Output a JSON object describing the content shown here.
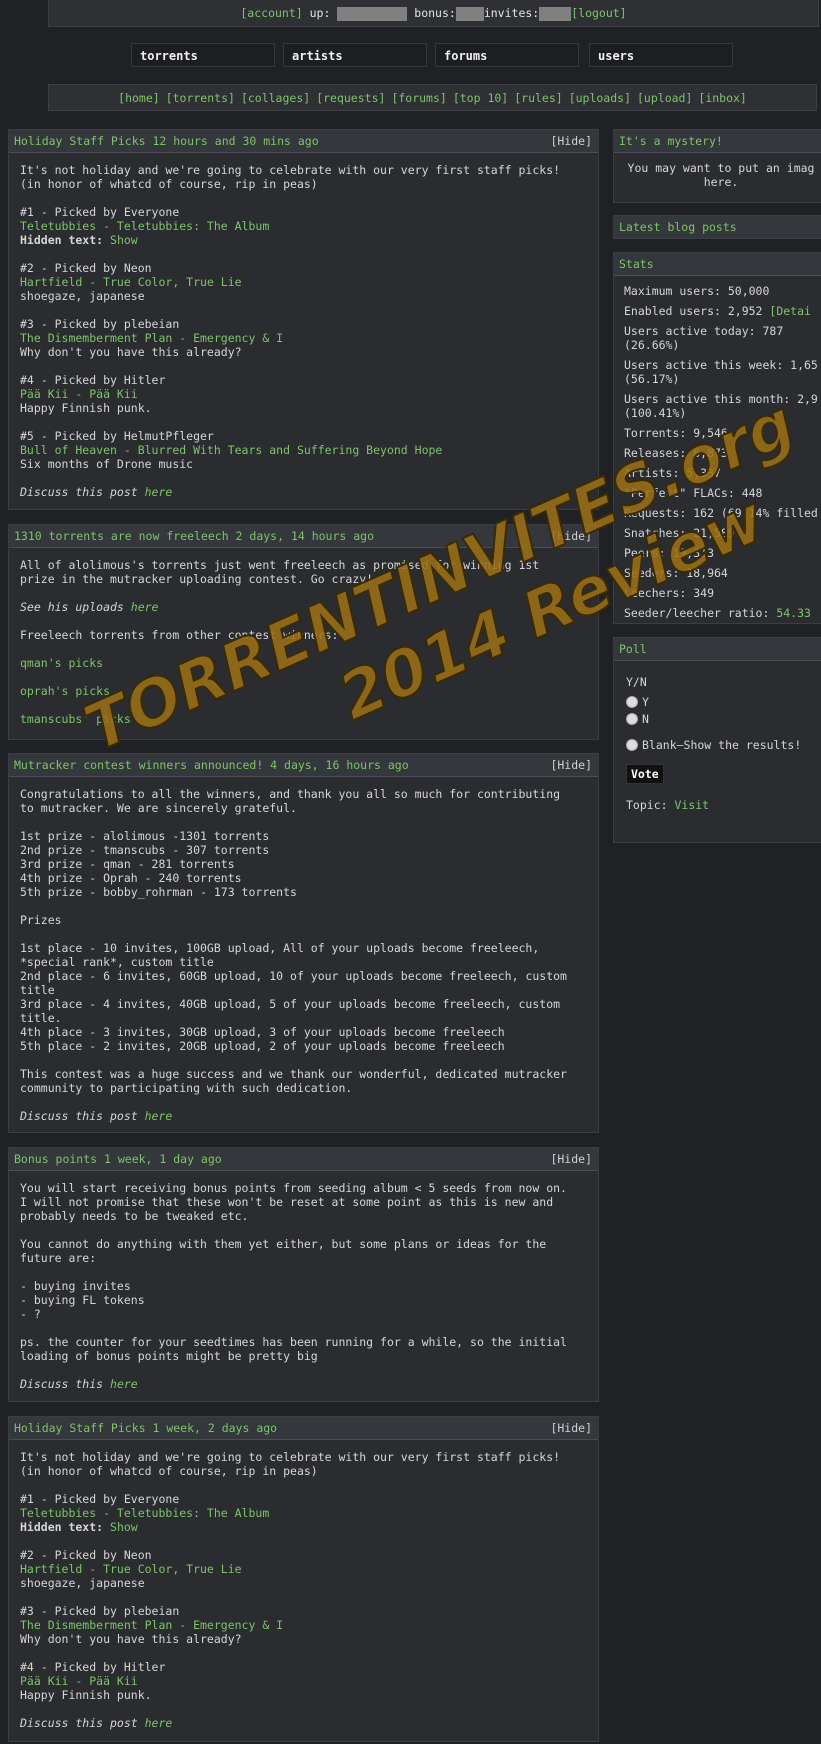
{
  "userbar": {
    "account": "[account]",
    "up_label": "up:",
    "bonus_label": "bonus:",
    "invites_label": "invites:",
    "logout": "[logout]"
  },
  "mainnav": [
    "torrents",
    "artists",
    "forums",
    "users"
  ],
  "subnav": [
    "[home]",
    "[torrents]",
    "[collages]",
    "[requests]",
    "[forums]",
    "[top 10]",
    "[rules]",
    "[uploads]",
    "[upload]",
    "[inbox]"
  ],
  "posts": [
    {
      "title": "Holiday Staff Picks 12 hours and 30 mins ago",
      "hide": "[Hide]",
      "lines": [
        {
          "t": "It's not holiday and we're going to celebrate with our very first staff picks!"
        },
        {
          "t": "(in honor of whatcd of course, rip in peas)"
        },
        {
          "gap": true
        },
        {
          "t": "#1 - Picked by Everyone"
        },
        {
          "t": "Teletubbies - Teletubbies: The Album",
          "c": "green"
        },
        {
          "t": "Hidden text:",
          "c": "bold",
          "suffix": " Show"
        },
        {
          "gap": true
        },
        {
          "t": "#2 - Picked by Neon"
        },
        {
          "t": "Hartfield - True Color, True Lie",
          "c": "green"
        },
        {
          "t": "shoegaze, japanese"
        },
        {
          "gap": true
        },
        {
          "t": "#3 - Picked by plebeian"
        },
        {
          "t": "The Dismemberment Plan - Emergency & I",
          "c": "green"
        },
        {
          "t": "Why don't you have this already?"
        },
        {
          "gap": true
        },
        {
          "t": "#4 - Picked by Hitler"
        },
        {
          "t": "Pää Kii - Pää Kii",
          "c": "green"
        },
        {
          "t": "Happy Finnish punk."
        },
        {
          "gap": true
        },
        {
          "t": "#5 - Picked by HelmutPfleger"
        },
        {
          "t": "Bull of Heaven - Blurred With Tears and Suffering Beyond Hope",
          "c": "green"
        },
        {
          "t": "Six months of Drone music"
        },
        {
          "gap": true
        },
        {
          "t": "Discuss this post ",
          "c": "ital",
          "suffix": "here"
        }
      ]
    },
    {
      "title": "1310 torrents are now freeleech 2 days, 14 hours ago",
      "hide": "[Hide]",
      "lines": [
        {
          "t": "All of alolimous's torrents just went freeleech as promised for winning 1st"
        },
        {
          "t": "prize in the mutracker uploading contest. Go crazy!"
        },
        {
          "gap": true
        },
        {
          "t": "See his uploads ",
          "c": "ital",
          "suffix": "here"
        },
        {
          "gap": true
        },
        {
          "t": "Freeleech torrents from other contest winners:"
        },
        {
          "gap": true
        },
        {
          "t": "qman's picks",
          "c": "green"
        },
        {
          "gap": true
        },
        {
          "t": "oprah's picks",
          "c": "green"
        },
        {
          "gap": true
        },
        {
          "t": "tmanscubs' picks",
          "c": "green"
        }
      ]
    },
    {
      "title": "Mutracker contest winners announced! 4 days, 16 hours ago",
      "hide": "[Hide]",
      "lines": [
        {
          "t": "Congratulations to all the winners, and thank you all so much for contributing"
        },
        {
          "t": "to mutracker. We are sincerely grateful."
        },
        {
          "gap": true
        },
        {
          "t": "1st prize - alolimous -1301 torrents"
        },
        {
          "t": "2nd prize - tmanscubs - 307 torrents"
        },
        {
          "t": "3rd prize - qman - 281 torrents"
        },
        {
          "t": "4th prize - Oprah - 240 torrents"
        },
        {
          "t": "5th prize - bobby_rohrman - 173 torrents"
        },
        {
          "gap": true
        },
        {
          "t": "Prizes"
        },
        {
          "gap": true
        },
        {
          "t": "1st place - 10 invites, 100GB upload, All of your uploads become freeleech,"
        },
        {
          "t": "*special rank*, custom title"
        },
        {
          "t": "2nd place - 6 invites, 60GB upload, 10 of your uploads become freeleech, custom"
        },
        {
          "t": "title"
        },
        {
          "t": "3rd place - 4 invites, 40GB upload, 5 of your uploads become freeleech, custom"
        },
        {
          "t": "title."
        },
        {
          "t": "4th place - 3 invites, 30GB upload, 3 of your uploads become freeleech"
        },
        {
          "t": "5th place - 2 invites, 20GB upload, 2 of your uploads become freeleech"
        },
        {
          "gap": true
        },
        {
          "t": "This contest was a huge success and we thank our wonderful, dedicated mutracker"
        },
        {
          "t": "community to participating with such dedication."
        },
        {
          "gap": true
        },
        {
          "t": "Discuss this post ",
          "c": "ital",
          "suffix": "here"
        }
      ]
    },
    {
      "title": "Bonus points 1 week, 1 day ago",
      "hide": "[Hide]",
      "lines": [
        {
          "t": "You will start receiving bonus points from seeding album < 5 seeds from now on."
        },
        {
          "t": "I will not promise that these won't be reset at some point as this is new and"
        },
        {
          "t": "probably needs to be tweaked etc."
        },
        {
          "gap": true
        },
        {
          "t": "You cannot do anything with them yet either, but some plans or ideas for the"
        },
        {
          "t": "future are:"
        },
        {
          "gap": true
        },
        {
          "t": "- buying invites"
        },
        {
          "t": "- buying FL tokens"
        },
        {
          "t": "- ?"
        },
        {
          "gap": true
        },
        {
          "t": "ps. the counter for your seedtimes has been running for a while, so the initial"
        },
        {
          "t": "loading of bonus points might be pretty big"
        },
        {
          "gap": true
        },
        {
          "t": "Discuss this ",
          "c": "ital",
          "suffix": "here"
        }
      ]
    },
    {
      "title": "Holiday Staff Picks 1 week, 2 days ago",
      "hide": "[Hide]",
      "lines": [
        {
          "t": "It's not holiday and we're going to celebrate with our very first staff picks!"
        },
        {
          "t": "(in honor of whatcd of course, rip in peas)"
        },
        {
          "gap": true
        },
        {
          "t": "#1 - Picked by Everyone"
        },
        {
          "t": "Teletubbies - Teletubbies: The Album",
          "c": "green"
        },
        {
          "t": "Hidden text:",
          "c": "bold",
          "suffix": " Show"
        },
        {
          "gap": true
        },
        {
          "t": "#2 - Picked by Neon"
        },
        {
          "t": "Hartfield - True Color, True Lie",
          "c": "green"
        },
        {
          "t": "shoegaze, japanese"
        },
        {
          "gap": true
        },
        {
          "t": "#3 - Picked by plebeian"
        },
        {
          "t": "The Dismemberment Plan - Emergency & I",
          "c": "green"
        },
        {
          "t": "Why don't you have this already?"
        },
        {
          "gap": true
        },
        {
          "t": "#4 - Picked by Hitler"
        },
        {
          "t": "Pää Kii - Pää Kii",
          "c": "green"
        },
        {
          "t": "Happy Finnish punk."
        },
        {
          "gap": true
        },
        {
          "t": "Discuss this post ",
          "c": "ital",
          "suffix": "here"
        }
      ]
    }
  ],
  "sidebar": {
    "mystery": {
      "title": "It's a mystery!",
      "text1": "You may want to put an imag",
      "text2": "here."
    },
    "blog": {
      "title": "Latest blog posts"
    },
    "stats": {
      "title": "Stats",
      "items": [
        {
          "t": "Maximum users: 50,000"
        },
        {
          "t": "Enabled users: 2,952 ",
          "extra": "[Detai"
        },
        {
          "t": "Users active today: 787",
          "t2": "(26.66%)"
        },
        {
          "t": "Users active this week: 1,65",
          "t2": "(56.17%)"
        },
        {
          "t": "Users active this month: 2,9",
          "t2": "(100.41%)"
        },
        {
          "t": "Torrents: 9,546"
        },
        {
          "t": "Releases: 6,873"
        },
        {
          "t": "Artists: 5,337"
        },
        {
          "t": "\"Perfect\" FLACs: 448"
        },
        {
          "t": "Requests: 162 (69.14% filled"
        },
        {
          "t": "Snatches: 21,589"
        },
        {
          "t": "Peers: 19,313"
        },
        {
          "t": "Seeders: 18,964"
        },
        {
          "t": "Leechers: 349"
        },
        {
          "t": "Seeder/leecher ratio: ",
          "extra": "54.33"
        }
      ]
    },
    "poll": {
      "title": "Poll",
      "question": "Y/N",
      "options": [
        "Y",
        "N"
      ],
      "blank": "Blank—Show the results!",
      "vote": "Vote",
      "topic_label": "Topic:",
      "topic_link": "Visit"
    }
  },
  "watermark": {
    "line1": "TORRENTINVITES.org",
    "line2": "2014 Review"
  }
}
